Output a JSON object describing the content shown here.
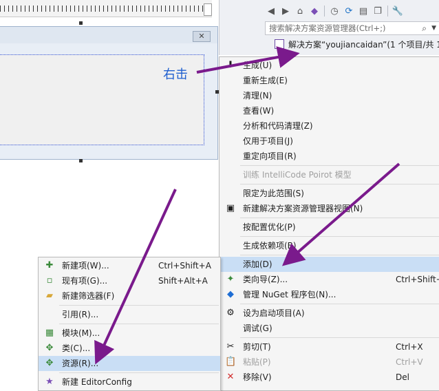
{
  "annotation": "右击",
  "colors": {
    "arrow": "#7a1a8c",
    "highlight": "#c9def5",
    "annotation": "#1f5fcf",
    "selection": "#2d4fd6"
  },
  "form": {
    "close_glyph": "✕"
  },
  "solution_explorer": {
    "toolbar_icons": [
      "back-icon",
      "forward-icon",
      "home-icon",
      "vs-icon",
      "history-icon",
      "sync-icon",
      "collapse-icon",
      "copy-icon",
      "wrench-icon"
    ],
    "search_placeholder": "搜索解决方案资源管理器(Ctrl+;)",
    "search_icon": "⌕",
    "solution_row": "解决方案“youjiancaidan”(1 个项目/共 1"
  },
  "main_menu": {
    "items": [
      {
        "label": "生成(U)",
        "icon": "build-icon",
        "glyph": "⬇"
      },
      {
        "label": "重新生成(E)"
      },
      {
        "label": "清理(N)"
      },
      {
        "label": "查看(W)"
      },
      {
        "label": "分析和代码清理(Z)"
      },
      {
        "label": "仅用于项目(J)"
      },
      {
        "label": "重定向项目(R)"
      },
      {
        "sep": true
      },
      {
        "label": "训练 IntelliCode Poirot 模型",
        "disabled": true
      },
      {
        "sep": true
      },
      {
        "label": "限定为此范围(S)"
      },
      {
        "label": "新建解决方案资源管理器视图(N)",
        "icon": "new-view-icon",
        "glyph": "▣"
      },
      {
        "sep": true
      },
      {
        "label": "按配置优化(P)"
      },
      {
        "sep": true
      },
      {
        "label": "生成依赖项(B)"
      },
      {
        "sep": true
      },
      {
        "label": "添加(D)",
        "highlight": true
      },
      {
        "label": "类向导(Z)...",
        "shortcut": "Ctrl+Shift+",
        "icon": "class-wizard-icon",
        "glyph": "✦"
      },
      {
        "label": "管理 NuGet 程序包(N)...",
        "icon": "nuget-icon",
        "glyph": "◆"
      },
      {
        "sep": true
      },
      {
        "label": "设为启动项目(A)",
        "icon": "gear-icon",
        "glyph": "⚙"
      },
      {
        "label": "调试(G)"
      },
      {
        "sep": true
      },
      {
        "label": "剪切(T)",
        "shortcut": "Ctrl+X",
        "icon": "cut-icon",
        "glyph": "✂"
      },
      {
        "label": "粘贴(P)",
        "shortcut": "Ctrl+V",
        "disabled": true,
        "icon": "paste-icon",
        "glyph": "📋"
      },
      {
        "label": "移除(V)",
        "shortcut": "Del",
        "icon": "remove-icon",
        "glyph": "✕"
      }
    ]
  },
  "add_submenu": {
    "items": [
      {
        "label": "新建项(W)...",
        "shortcut": "Ctrl+Shift+A",
        "icon": "new-item-icon",
        "glyph": "✚"
      },
      {
        "label": "现有项(G)...",
        "shortcut": "Shift+Alt+A",
        "icon": "existing-item-icon",
        "glyph": "▫"
      },
      {
        "label": "新建筛选器(F)",
        "icon": "folder-icon",
        "glyph": "▰"
      },
      {
        "sep": true
      },
      {
        "label": "引用(R)..."
      },
      {
        "sep": true
      },
      {
        "label": "模块(M)...",
        "icon": "module-icon",
        "glyph": "▦"
      },
      {
        "label": "类(C)...",
        "icon": "class-icon",
        "glyph": "✥"
      },
      {
        "label": "资源(R)...",
        "highlight": true,
        "icon": "resource-icon",
        "glyph": "✥"
      },
      {
        "sep": true
      },
      {
        "label": "新建 EditorConfig",
        "icon": "editorconfig-icon",
        "glyph": "★"
      }
    ]
  }
}
